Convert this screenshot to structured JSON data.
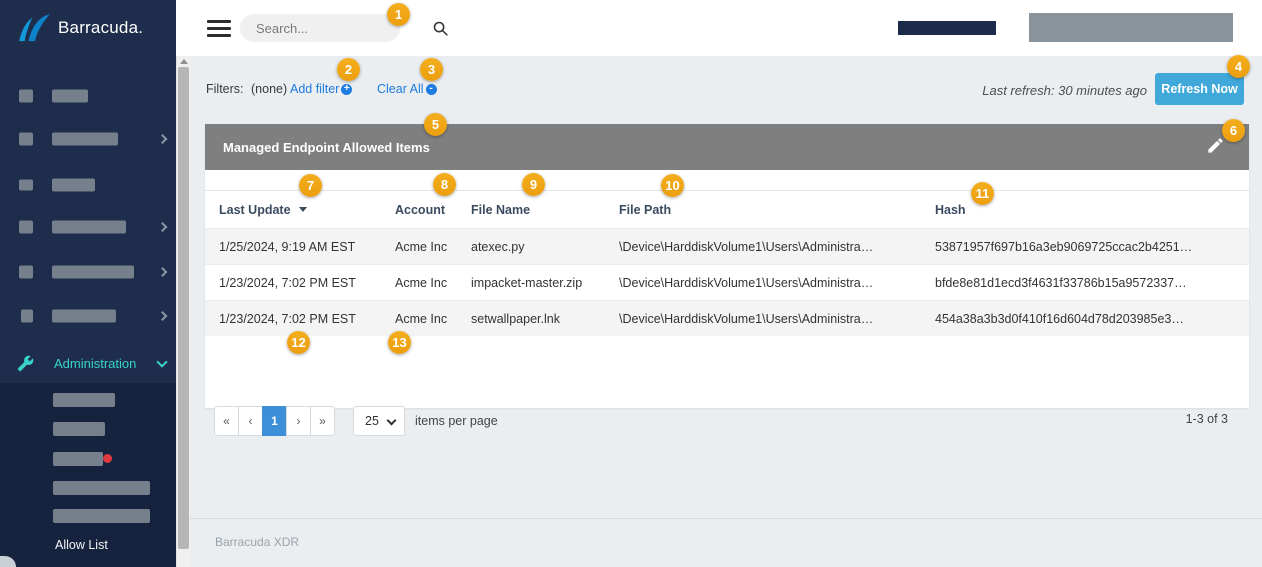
{
  "sidebar": {
    "logo_text": "Barracuda.",
    "administration_label": "Administration",
    "allow_list_label": "Allow List"
  },
  "topbar": {
    "search_placeholder": "Search..."
  },
  "filters": {
    "label": "Filters:",
    "value": "(none)",
    "add_filter_label": "Add filter",
    "clear_all_label": "Clear All"
  },
  "icons": {
    "add_glyph": "+",
    "remove_glyph": "-"
  },
  "refresh": {
    "last_refresh_text": "Last refresh: 30 minutes ago",
    "button_label": "Refresh Now"
  },
  "panel": {
    "title": "Managed Endpoint Allowed Items"
  },
  "table": {
    "columns": [
      "Last Update",
      "Account",
      "File Name",
      "File Path",
      "Hash"
    ],
    "rows": [
      [
        "1/25/2024, 9:19 AM EST",
        "Acme Inc",
        "atexec.py",
        "\\Device\\HarddiskVolume1\\Users\\Administra…",
        "53871957f697b16a3eb9069725ccac2b4251…"
      ],
      [
        "1/23/2024, 7:02 PM EST",
        "Acme Inc",
        "impacket-master.zip",
        "\\Device\\HarddiskVolume1\\Users\\Administra…",
        "bfde8e81d1ecd3f4631f33786b15a9572337…"
      ],
      [
        "1/23/2024, 7:02 PM EST",
        "Acme Inc",
        "setwallpaper.lnk",
        "\\Device\\HarddiskVolume1\\Users\\Administra…",
        "454a38a3b3d0f410f16d604d78d203985e3…"
      ]
    ]
  },
  "pagination": {
    "first": "«",
    "prev": "‹",
    "current_page": "1",
    "next": "›",
    "last": "»",
    "page_size": "25",
    "items_per_page_label": "items per page",
    "range_label": "1-3 of 3"
  },
  "footer": {
    "app_name": "Barracuda XDR"
  },
  "annotations": {
    "labels": [
      "1",
      "2",
      "3",
      "4",
      "5",
      "6",
      "7",
      "8",
      "9",
      "10",
      "11",
      "12",
      "13"
    ]
  },
  "colors": {
    "accent_teal": "#38d3ca",
    "link_blue": "#1e7be0",
    "refresh_button_blue": "#41a8da",
    "active_page_blue": "#3d8fd8",
    "badge_orange": "#f0a41c",
    "panel_header_gray": "#7f7f7f",
    "sidebar_navy": "#1e2d4b"
  }
}
